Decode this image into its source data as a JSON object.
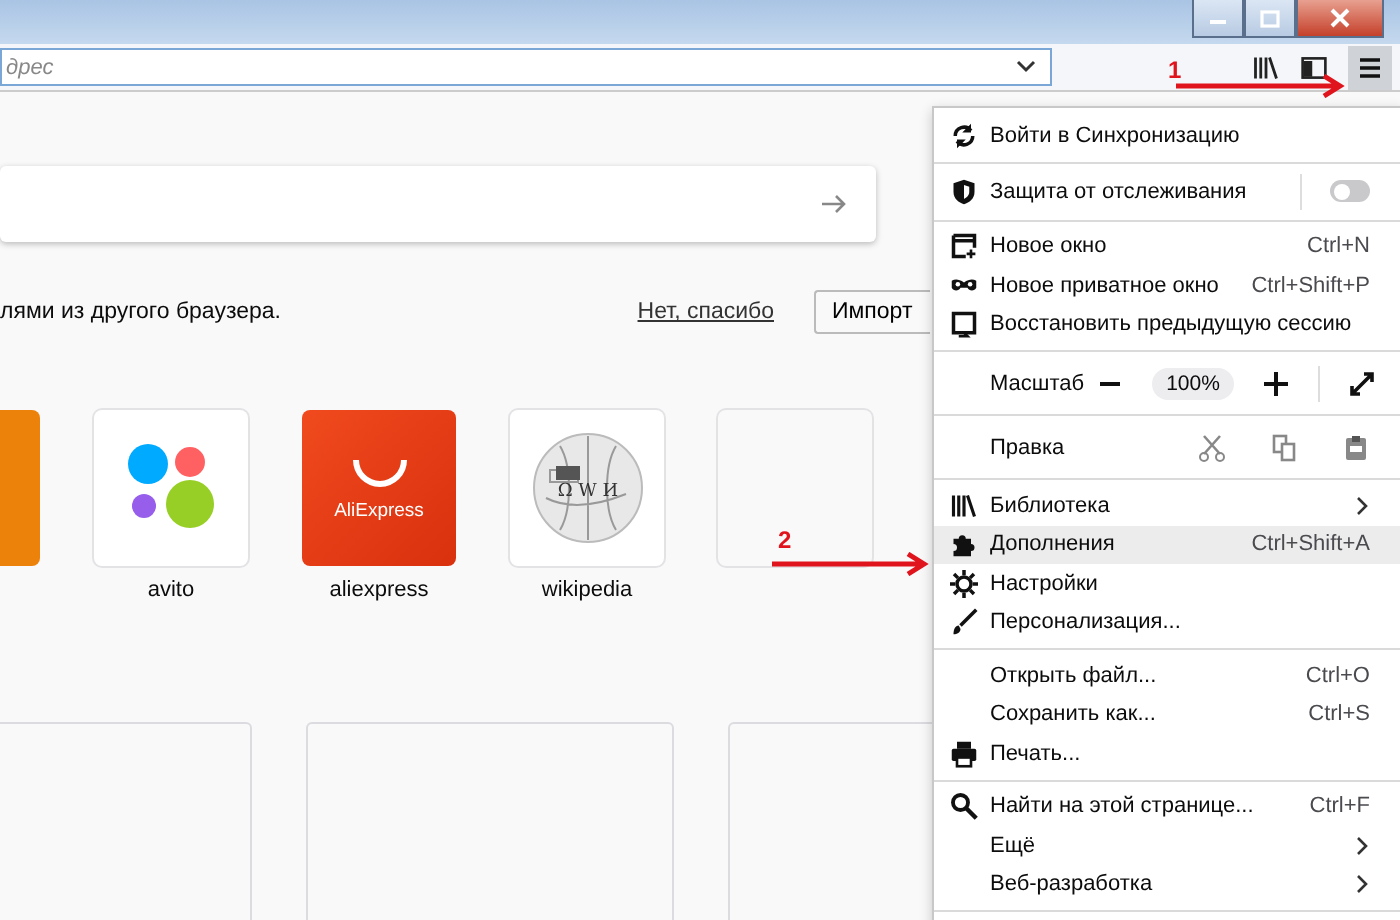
{
  "toolbar": {
    "address_placeholder": "дрес",
    "menu_button_selected": true
  },
  "search_box": {
    "kind": "search"
  },
  "import_bar": {
    "message": "лями из другого браузера.",
    "decline_link": "Нет, спасибо",
    "import_button": "Импорт"
  },
  "top_sites": [
    {
      "kind": "orange"
    },
    {
      "kind": "avito",
      "label": "avito"
    },
    {
      "kind": "aliexpress",
      "label": "aliexpress",
      "logo_text": "AliExpress"
    },
    {
      "kind": "wikipedia",
      "label": "wikipedia",
      "logo_letters": "Ω W И"
    },
    {
      "kind": "empty"
    }
  ],
  "highlights": [
    {
      "kind": "empty"
    },
    {
      "kind": "empty"
    },
    {
      "kind": "empty"
    }
  ],
  "menu": {
    "sections": [
      [
        {
          "kind": "item",
          "label": "Войти в Синхронизацию",
          "selected": false
        }
      ],
      [
        {
          "kind": "toggle",
          "label": "Защита от отслеживания",
          "on": false
        }
      ],
      [
        {
          "kind": "item",
          "label": "Новое окно",
          "shortcut": "Ctrl+N",
          "selected": false
        },
        {
          "kind": "item",
          "label": "Новое приватное окно",
          "shortcut": "Ctrl+Shift+P",
          "selected": false
        },
        {
          "kind": "item",
          "label": "Восстановить предыдущую сессию",
          "selected": false
        }
      ],
      [
        {
          "kind": "zoom",
          "label": "Масштаб",
          "value": "100%"
        }
      ],
      [
        {
          "kind": "edit",
          "label": "Правка"
        }
      ],
      [
        {
          "kind": "item",
          "label": "Библиотека",
          "submenu": true,
          "selected": false
        },
        {
          "kind": "item",
          "label": "Дополнения",
          "shortcut": "Ctrl+Shift+A",
          "selected": true
        },
        {
          "kind": "item",
          "label": "Настройки",
          "selected": false
        },
        {
          "kind": "item",
          "label": "Персонализация...",
          "selected": false
        }
      ],
      [
        {
          "kind": "item",
          "label": "Открыть файл...",
          "shortcut": "Ctrl+O",
          "selected": false
        },
        {
          "kind": "item",
          "label": "Сохранить как...",
          "shortcut": "Ctrl+S",
          "selected": false
        },
        {
          "kind": "item",
          "label": "Печать...",
          "selected": false
        }
      ],
      [
        {
          "kind": "item",
          "label": "Найти на этой странице...",
          "shortcut": "Ctrl+F",
          "selected": false
        },
        {
          "kind": "item",
          "label": "Ещё",
          "submenu": true,
          "selected": false
        },
        {
          "kind": "item",
          "label": "Веб-разработка",
          "submenu": true,
          "selected": false
        }
      ]
    ]
  },
  "annotations": [
    {
      "label": "1"
    },
    {
      "label": "2"
    }
  ]
}
